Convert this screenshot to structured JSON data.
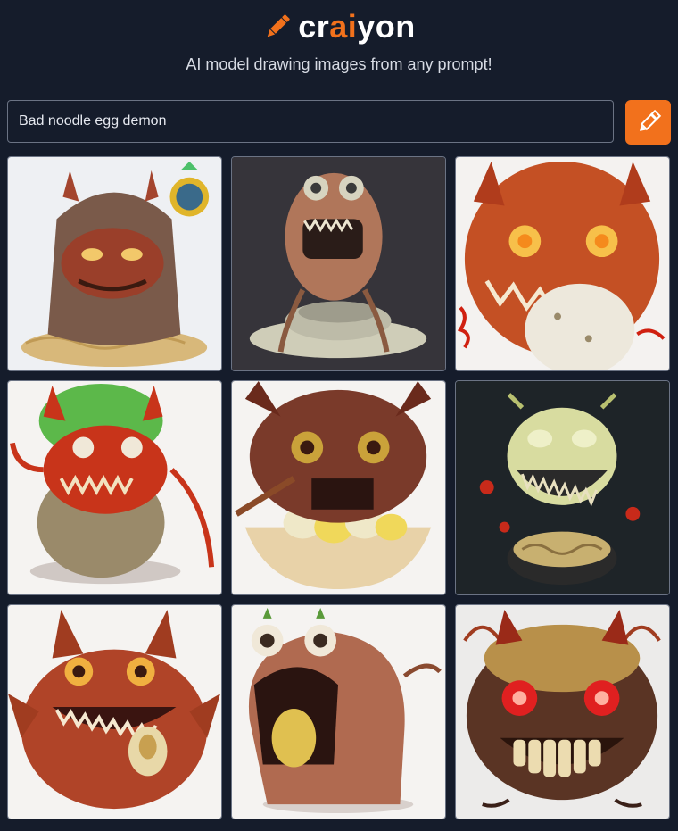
{
  "header": {
    "logo_text_pre": "cr",
    "logo_text_accent": "ai",
    "logo_text_post": "yon",
    "tagline": "AI model drawing images from any prompt!"
  },
  "prompt": {
    "value": "Bad noodle egg demon",
    "draw_button_icon": "pencil-icon"
  },
  "colors": {
    "background": "#151c2b",
    "accent": "#f2711c",
    "border": "#6b7384"
  },
  "gallery": {
    "image_count": 9
  }
}
